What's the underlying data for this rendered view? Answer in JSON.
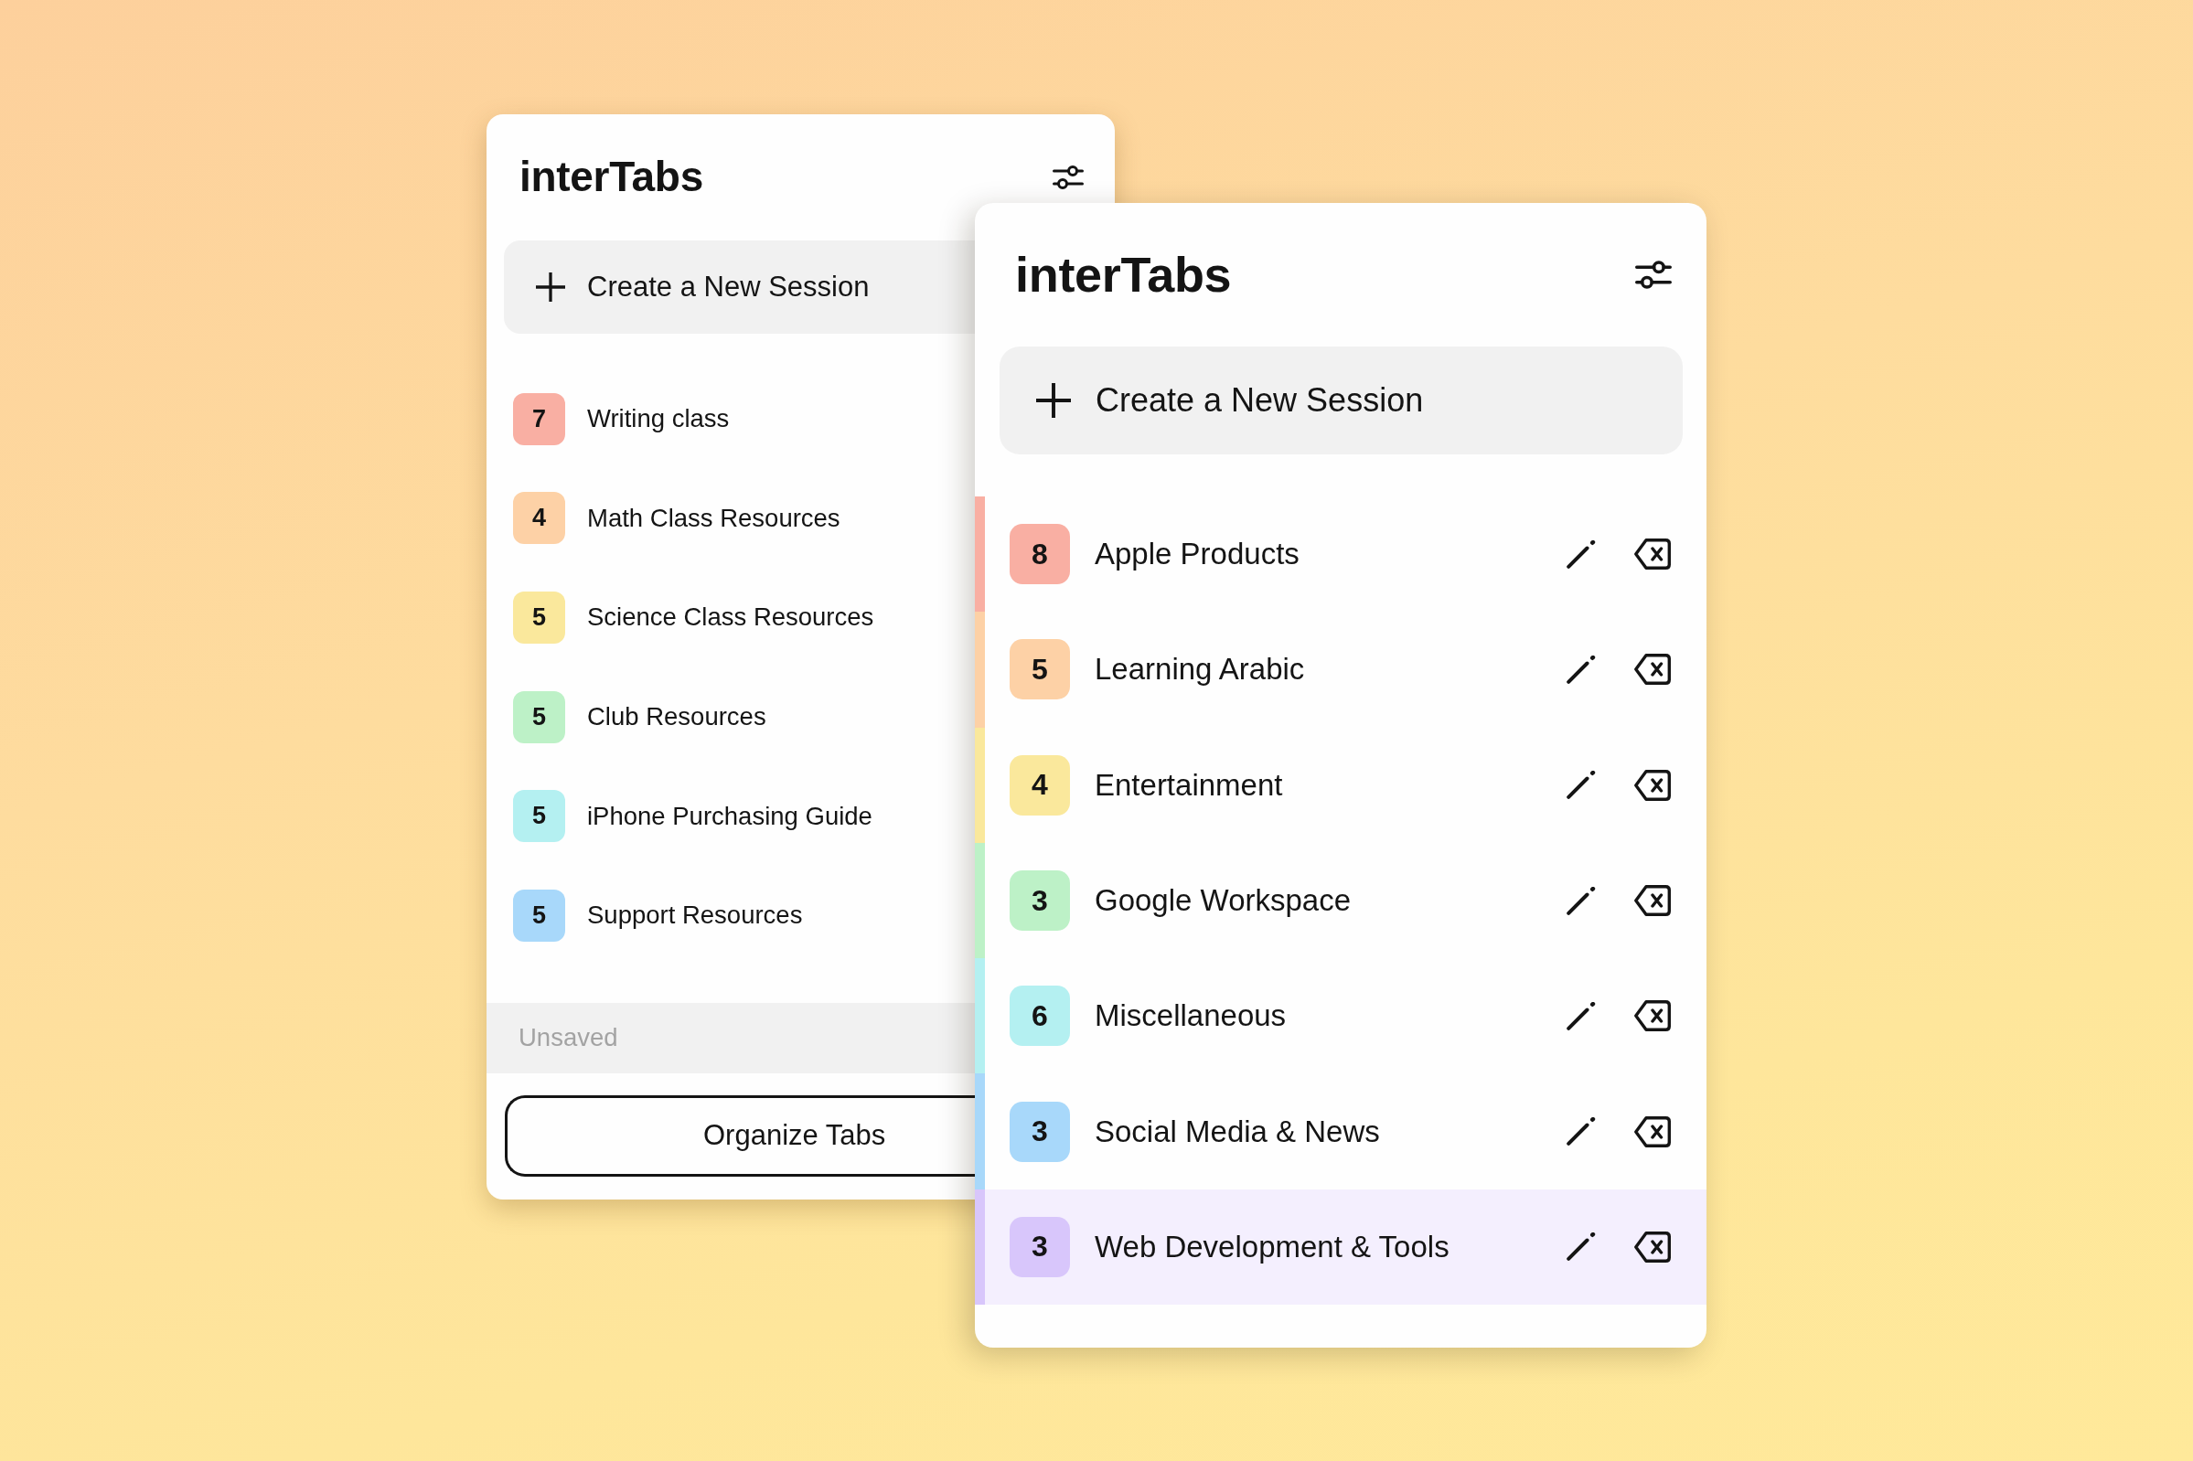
{
  "back_panel": {
    "title": "interTabs",
    "create_button": "Create a New Session",
    "sessions": [
      {
        "count": "7",
        "name": "Writing class",
        "color": "#f9afa3"
      },
      {
        "count": "4",
        "name": "Math Class Resources",
        "color": "#fdd1a6"
      },
      {
        "count": "5",
        "name": "Science Class Resources",
        "color": "#fae89c"
      },
      {
        "count": "5",
        "name": "Club Resources",
        "color": "#bdf1c7"
      },
      {
        "count": "5",
        "name": "iPhone Purchasing Guide",
        "color": "#b4f0f1"
      },
      {
        "count": "5",
        "name": "Support Resources",
        "color": "#a8d8fa"
      }
    ],
    "unsaved_label": "Unsaved",
    "organize_button": "Organize Tabs"
  },
  "front_panel": {
    "title": "interTabs",
    "create_button": "Create a New Session",
    "sessions": [
      {
        "count": "8",
        "name": "Apple Products",
        "color": "#f9afa3",
        "selected": false
      },
      {
        "count": "5",
        "name": "Learning Arabic",
        "color": "#fdd1a6",
        "selected": false
      },
      {
        "count": "4",
        "name": "Entertainment",
        "color": "#fae89c",
        "selected": false
      },
      {
        "count": "3",
        "name": "Google Workspace",
        "color": "#bdf1c7",
        "selected": false
      },
      {
        "count": "6",
        "name": "Miscellaneous",
        "color": "#b4f0f1",
        "selected": false
      },
      {
        "count": "3",
        "name": "Social Media & News",
        "color": "#a8d8fa",
        "selected": false
      },
      {
        "count": "3",
        "name": "Web Development & Tools",
        "color": "#d8c6fb",
        "selected": true
      }
    ]
  }
}
